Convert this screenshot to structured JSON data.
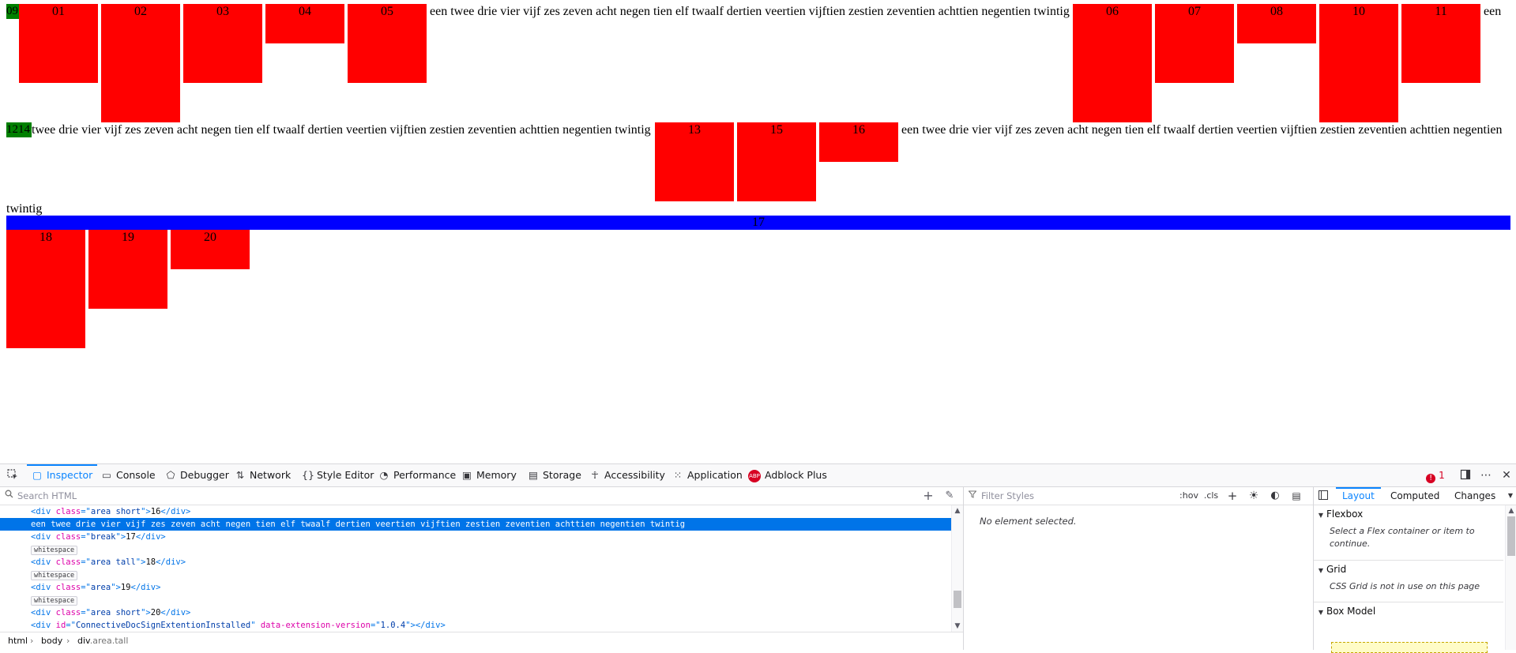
{
  "page": {
    "areas_row1": [
      {
        "label": "01",
        "height": "short"
      },
      {
        "label": "02",
        "height": "tall"
      },
      {
        "label": "03",
        "height": "short"
      },
      {
        "label": "04",
        "height": "mini"
      },
      {
        "label": "05",
        "height": "short"
      }
    ],
    "inline_text_full": "een twee drie vier vijf zes zeven acht negen tien elf twaalf dertien veertien vijftien zestien zeventien achttien negentien twintig",
    "areas_row1b": [
      {
        "label": "06",
        "height": "tall"
      },
      {
        "label": "07",
        "height": "short"
      },
      {
        "label": "08",
        "height": "mini"
      },
      {
        "label": "10",
        "height": "tall"
      },
      {
        "label": "11",
        "height": "short"
      }
    ],
    "trailing_word": "een",
    "green_label_1": "09",
    "green_label_2": "1214",
    "inline_text_partial": "twee drie vier vijf zes zeven acht negen tien elf twaalf dertien veertien vijftien zestien zeventien achttien negentien twintig",
    "areas_row2": [
      {
        "label": "13",
        "height": "short"
      },
      {
        "label": "15",
        "height": "short"
      },
      {
        "label": "16",
        "height": "mini"
      }
    ],
    "inline_text_no_last": "een twee drie vier vijf zes zeven acht negen tien elf twaalf dertien veertien vijftien zestien zeventien achttien negentien",
    "wrapped_word": "twintig",
    "break_label": "17",
    "areas_row3": [
      {
        "label": "18",
        "height": "tall"
      },
      {
        "label": "19",
        "height": "short"
      },
      {
        "label": "20",
        "height": "mini"
      }
    ]
  },
  "devtools": {
    "tabs": [
      {
        "label": "Inspector",
        "icon": "inspector-icon"
      },
      {
        "label": "Console",
        "icon": "console-icon"
      },
      {
        "label": "Debugger",
        "icon": "debugger-icon"
      },
      {
        "label": "Network",
        "icon": "network-icon"
      },
      {
        "label": "Style Editor",
        "icon": "style-editor-icon"
      },
      {
        "label": "Performance",
        "icon": "performance-icon"
      },
      {
        "label": "Memory",
        "icon": "memory-icon"
      },
      {
        "label": "Storage",
        "icon": "storage-icon"
      },
      {
        "label": "Accessibility",
        "icon": "accessibility-icon"
      },
      {
        "label": "Application",
        "icon": "application-icon"
      },
      {
        "label": "Adblock Plus",
        "icon": "adblock-plus-icon"
      }
    ],
    "adblock_icon_text": "ABP",
    "error_count": "1",
    "search_placeholder": "Search HTML",
    "markup_rows": [
      {
        "tag": "div",
        "attr": "class",
        "val": "area short",
        "text": "16"
      },
      {
        "selected_text": "een twee drie vier vijf zes zeven acht negen tien elf twaalf dertien veertien vijftien zestien zeventien achttien negentien twintig"
      },
      {
        "tag": "div",
        "attr": "class",
        "val": "break",
        "text": "17"
      },
      {
        "badge": "whitespace"
      },
      {
        "tag": "div",
        "attr": "class",
        "val": "area tall",
        "text": "18"
      },
      {
        "badge": "whitespace"
      },
      {
        "tag": "div",
        "attr": "class",
        "val": "area",
        "text": "19"
      },
      {
        "badge": "whitespace"
      },
      {
        "tag": "div",
        "attr": "class",
        "val": "area short",
        "text": "20"
      },
      {
        "tag": "div",
        "attr": "id",
        "val": "ConnectiveDocSignExtentionInstalled",
        "attr2": "data-extension-version",
        "val2": "1.0.4",
        "text": ""
      }
    ],
    "breadcrumbs": [
      {
        "label": "html"
      },
      {
        "label": "body"
      },
      {
        "label": "div",
        "cls": ".area.tall"
      }
    ],
    "filter_placeholder": "Filter Styles",
    "hov_label": ":hov",
    "cls_label": ".cls",
    "no_element_text": "No element selected.",
    "layout_tabs": [
      "Layout",
      "Computed",
      "Changes"
    ],
    "flexbox_title": "Flexbox",
    "flexbox_text": "Select a Flex container or item to continue.",
    "grid_title": "Grid",
    "grid_text": "CSS Grid is not in use on this page",
    "boxmodel_title": "Box Model"
  }
}
